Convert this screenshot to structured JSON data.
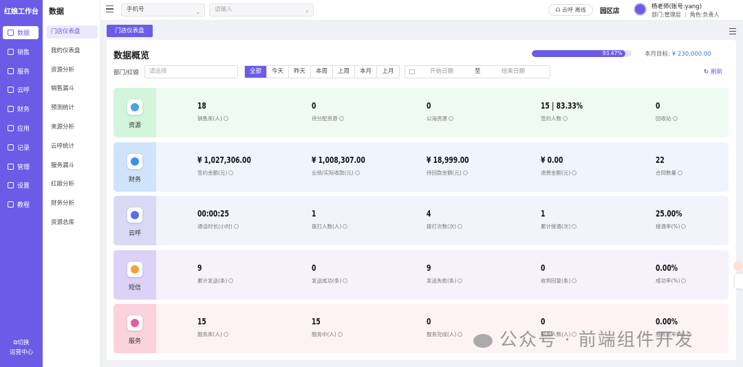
{
  "app": {
    "title": "红娘工作台"
  },
  "rail": {
    "items": [
      {
        "label": "数据",
        "icon": "chart-icon"
      },
      {
        "label": "销售",
        "icon": "grid-icon"
      },
      {
        "label": "服务",
        "icon": "heart-icon"
      },
      {
        "label": "云呼",
        "icon": "bar-chart-icon"
      },
      {
        "label": "财务",
        "icon": "wallet-icon"
      },
      {
        "label": "应用",
        "icon": "apps-icon"
      },
      {
        "label": "记录",
        "icon": "file-icon"
      },
      {
        "label": "管理",
        "icon": "monitor-icon"
      },
      {
        "label": "设置",
        "icon": "gear-icon"
      },
      {
        "label": "教程",
        "icon": "book-icon"
      }
    ],
    "switch_line1": "切换",
    "switch_line2": "运营中心"
  },
  "submenu": {
    "title": "数据",
    "items": [
      "门店仪表盘",
      "我的仪表盘",
      "资源分析",
      "销售漏斗",
      "预测统计",
      "来源分析",
      "云呼统计",
      "服务漏斗",
      "红娘分析",
      "财务分析",
      "资源总库"
    ]
  },
  "topbar": {
    "phone_select": "手机号",
    "search_placeholder": "请输入",
    "cloud_status": "云呼 离线",
    "store": "园区店",
    "user_name": "杨老师(账号:yang)",
    "user_role": "部门:管理层 ｜ 角色:负责人"
  },
  "tabs": [
    "门店仪表盘"
  ],
  "overview": {
    "title": "数据概览",
    "progress_text": "93.47%",
    "progress_value": 0.9347,
    "target_label": "本月目标:",
    "target_value": "¥ 230,000.00",
    "filter_label": "部门/红娘",
    "filter_placeholder": "请选择",
    "periods": [
      "全部",
      "今天",
      "昨天",
      "本周",
      "上周",
      "本月",
      "上月"
    ],
    "date_start": "开始日期",
    "date_sep": "至",
    "date_end": "结束日期",
    "refresh": "刷新"
  },
  "rows": [
    {
      "label": "资源",
      "icon": "user-icon",
      "bg": "#effaf2",
      "cat_bg": "#d3f5dc",
      "icon_color": "#4aa3df",
      "metrics": [
        {
          "v": "18",
          "k": "销售库(人)"
        },
        {
          "v": "0",
          "k": "待分配资源"
        },
        {
          "v": "0",
          "k": "公海资源"
        },
        {
          "v": "15 | 83.33%",
          "k": "签约人数"
        },
        {
          "v": "0",
          "k": "回收站"
        }
      ]
    },
    {
      "label": "财务",
      "icon": "finance-icon",
      "bg": "#eef5fd",
      "cat_bg": "#cfe4fb",
      "icon_color": "#3b8fe6",
      "metrics": [
        {
          "v": "¥ 1,027,306.00",
          "k": "签约金额(元)"
        },
        {
          "v": "¥ 1,008,307.00",
          "k": "业绩/实际收款(元)"
        },
        {
          "v": "¥ 18,999.00",
          "k": "待回款金额(元)"
        },
        {
          "v": "¥ 0.00",
          "k": "退费金额(元)"
        },
        {
          "v": "22",
          "k": "合同数量"
        }
      ]
    },
    {
      "label": "云呼",
      "icon": "phone-icon",
      "bg": "#f3f3fb",
      "cat_bg": "#d9d9f5",
      "icon_color": "#5a6fe0",
      "metrics": [
        {
          "v": "00:00:25",
          "k": "通话时长(小时)"
        },
        {
          "v": "1",
          "k": "拨打人数(人)"
        },
        {
          "v": "4",
          "k": "拨打次数(次)"
        },
        {
          "v": "1",
          "k": "累计接通(次)"
        },
        {
          "v": "25.00%",
          "k": "接通率(%)"
        }
      ]
    },
    {
      "label": "短信",
      "icon": "message-icon",
      "bg": "#f5f2fc",
      "cat_bg": "#dcd2f7",
      "icon_color": "#f2a13b",
      "metrics": [
        {
          "v": "9",
          "k": "累计发送(条)"
        },
        {
          "v": "0",
          "k": "发送成功(条)"
        },
        {
          "v": "9",
          "k": "发送失败(条)"
        },
        {
          "v": "0",
          "k": "收到回复(条)"
        },
        {
          "v": "0.00%",
          "k": "成功率(%)"
        }
      ]
    },
    {
      "label": "服务",
      "icon": "service-icon",
      "bg": "#fdf3f5",
      "cat_bg": "#fad3dc",
      "icon_color": "#e0609a",
      "metrics": [
        {
          "v": "15",
          "k": "服务库(人)"
        },
        {
          "v": "15",
          "k": "服务中(人)"
        },
        {
          "v": "0",
          "k": "服务完成(人)"
        },
        {
          "v": "0",
          "k": "服务人数(人)"
        },
        {
          "v": "0.00%",
          "k": "服务比率(%)"
        }
      ]
    }
  ],
  "watermark": "公众号 · 前端组件开发"
}
